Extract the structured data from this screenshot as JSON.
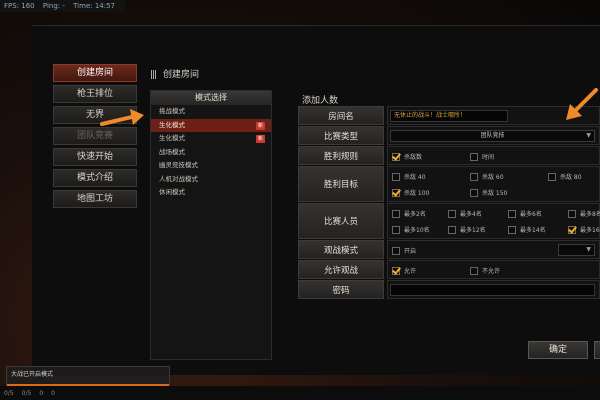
{
  "hud": {
    "fps": "FPS: 160",
    "ping": "Ping: -",
    "time": "Time: 14:57"
  },
  "sidebar": {
    "items": [
      {
        "label": "创建房间",
        "state": "active"
      },
      {
        "label": "枪王排位",
        "state": "normal"
      },
      {
        "label": "无界",
        "state": "normal"
      },
      {
        "label": "团队竞赛",
        "state": "dim"
      },
      {
        "label": "快速开始",
        "state": "normal"
      },
      {
        "label": "模式介绍",
        "state": "normal"
      },
      {
        "label": "地图工坊",
        "state": "normal"
      }
    ]
  },
  "panel": {
    "title": "创建房间"
  },
  "modes": {
    "header": "模式选择",
    "items": [
      {
        "label": "挑战模式",
        "tag": ""
      },
      {
        "label": "生化模式",
        "tag": "新",
        "selected": true
      },
      {
        "label": "生化模式",
        "tag": "新"
      },
      {
        "label": "战场模式",
        "tag": ""
      },
      {
        "label": "幽灵竞技模式",
        "tag": ""
      },
      {
        "label": "人机对战模式",
        "tag": ""
      },
      {
        "label": "休闲模式",
        "tag": ""
      }
    ]
  },
  "settings": {
    "title": "添加人数",
    "room_name": {
      "label": "房间名",
      "value": "无休止的战斗！战士哪所！"
    },
    "match_type": {
      "label": "比赛类型",
      "value": "团队竞技"
    },
    "victory_rule": {
      "label": "胜利规则",
      "options": [
        "杀敌数",
        "时间"
      ]
    },
    "victory_target": {
      "label": "胜利目标",
      "options": [
        "杀敌 40",
        "杀敌 60",
        "杀敌 80",
        "杀敌 100",
        "杀敌 150"
      ]
    },
    "players": {
      "label": "比赛人员",
      "options": [
        "最多2名",
        "最多4名",
        "最多6名",
        "最多8名",
        "最多10名",
        "最多12名",
        "最多14名",
        "最多16名"
      ]
    },
    "spectate_mode": {
      "label": "观战模式",
      "options": [
        "开启"
      ]
    },
    "allow_spectate": {
      "label": "允许观战",
      "options": [
        "允许",
        "不允许"
      ]
    },
    "password": {
      "label": "密码",
      "value": ""
    }
  },
  "actions": {
    "confirm": "确定"
  },
  "notice": {
    "text": "大战已开启模式"
  },
  "taskbar": {
    "items": [
      "0/5",
      "0/5",
      "0",
      "0"
    ]
  },
  "colors": {
    "accent": "#f08a2a",
    "active_tab": "#6b2a1c",
    "check": "#f0b030"
  }
}
